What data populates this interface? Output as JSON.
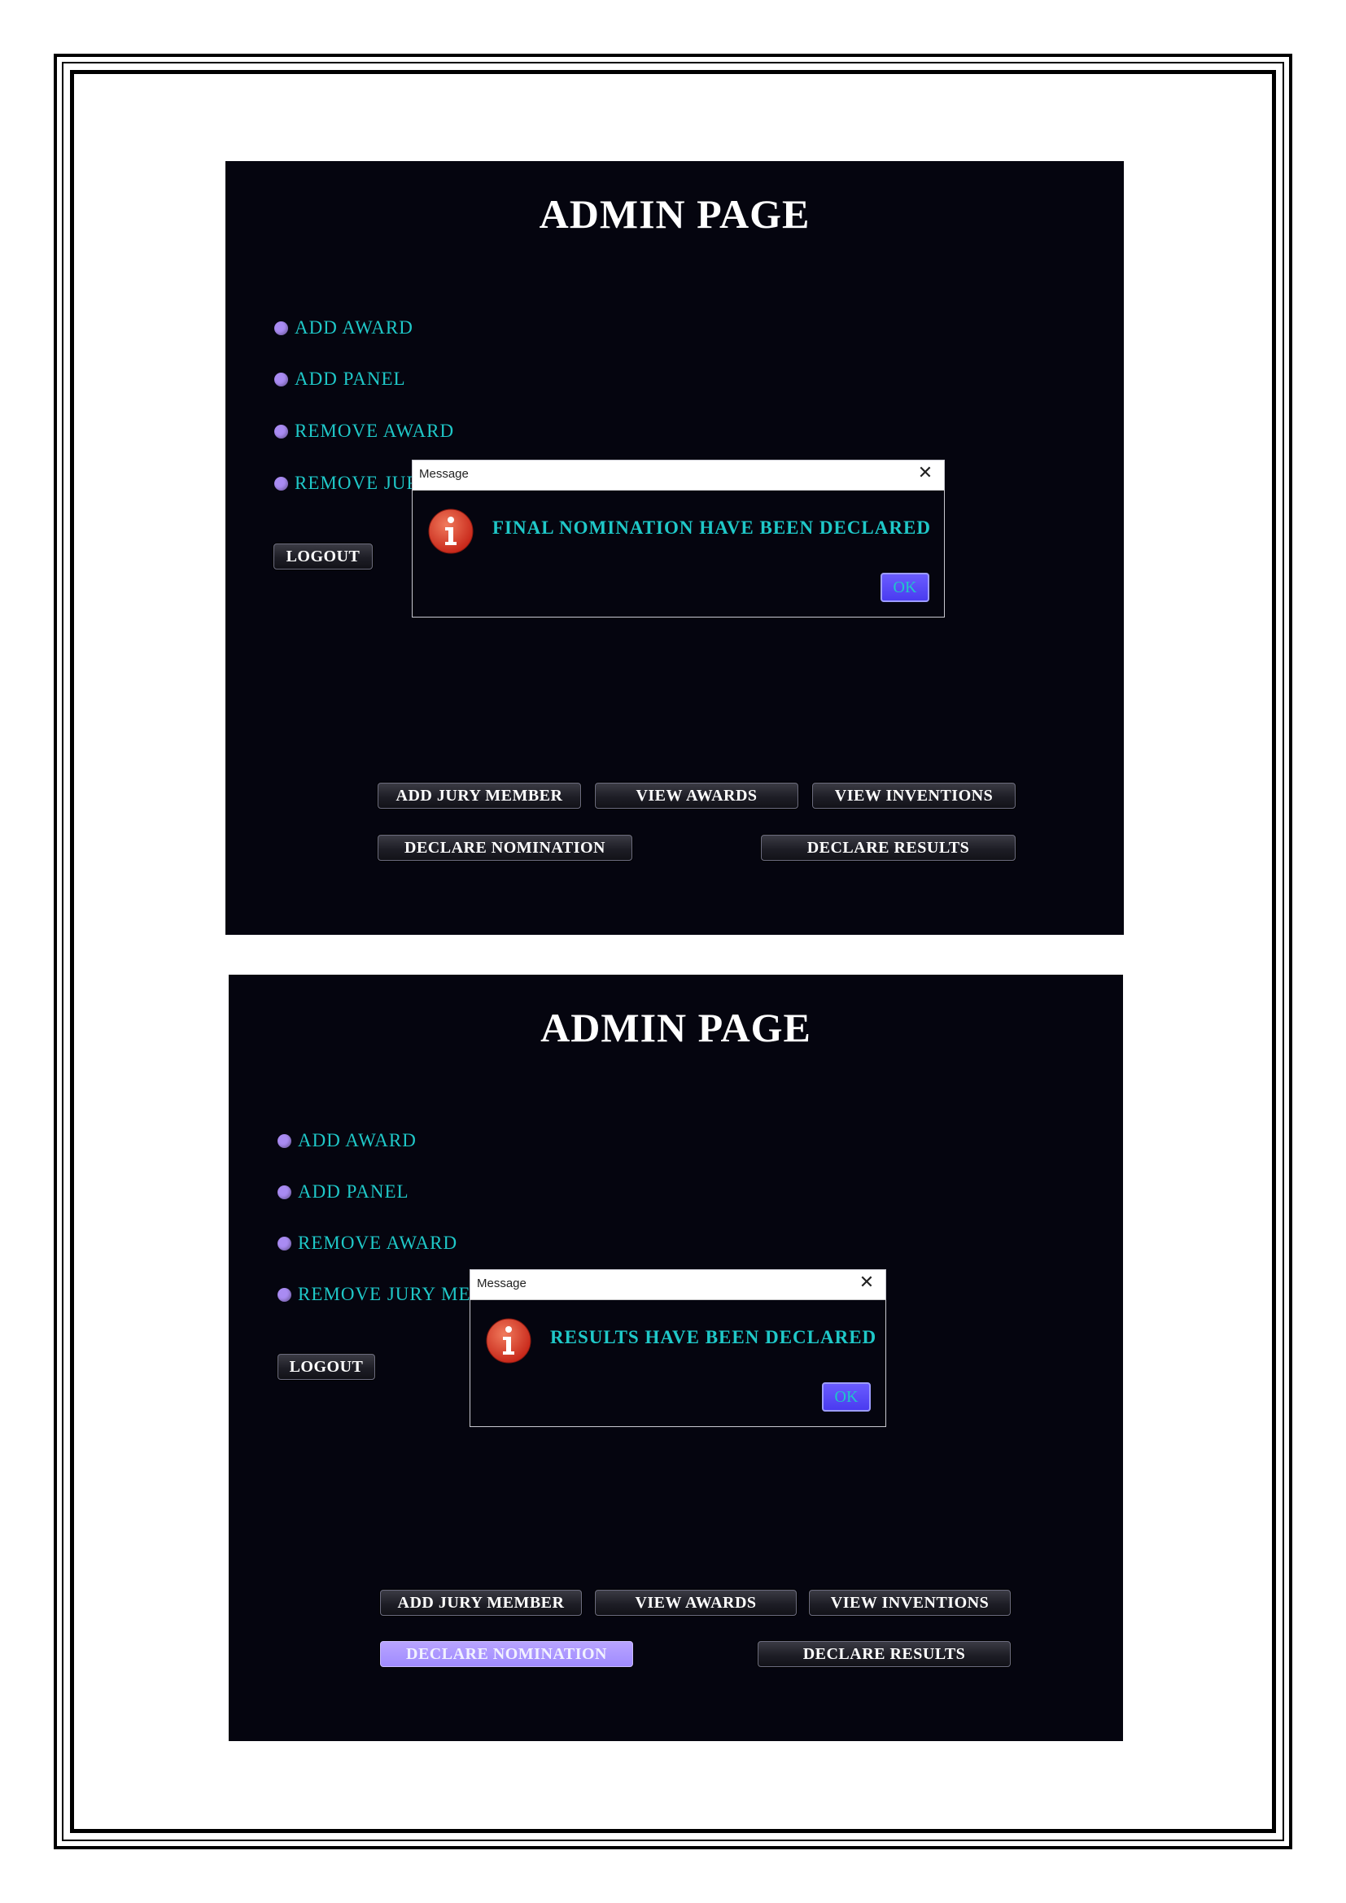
{
  "screens": [
    {
      "title": "ADMIN PAGE",
      "menu": [
        "ADD AWARD",
        "ADD PANEL",
        "REMOVE AWARD",
        "REMOVE JURY MEMBER"
      ],
      "logout_label": "LOGOUT",
      "buttons": {
        "add_jury_member": "ADD JURY MEMBER",
        "view_awards": "VIEW AWARDS",
        "view_inventions": "VIEW INVENTIONS",
        "declare_nomination": "DECLARE NOMINATION",
        "declare_results": "DECLARE RESULTS"
      },
      "declare_nomination_active": false,
      "dialog": {
        "title": "Message",
        "close_icon": "close-icon",
        "icon": "info-icon",
        "message": "FINAL NOMINATION HAVE BEEN DECLARED",
        "ok_label": "OK"
      }
    },
    {
      "title": "ADMIN PAGE",
      "menu": [
        "ADD AWARD",
        "ADD PANEL",
        "REMOVE AWARD",
        "REMOVE JURY MEMBER"
      ],
      "logout_label": "LOGOUT",
      "buttons": {
        "add_jury_member": "ADD JURY MEMBER",
        "view_awards": "VIEW AWARDS",
        "view_inventions": "VIEW INVENTIONS",
        "declare_nomination": "DECLARE NOMINATION",
        "declare_results": "DECLARE RESULTS"
      },
      "declare_nomination_active": true,
      "dialog": {
        "title": "Message",
        "close_icon": "close-icon",
        "icon": "info-icon",
        "message": "RESULTS HAVE BEEN DECLARED",
        "ok_label": "OK"
      }
    }
  ],
  "colors": {
    "background": "#05050f",
    "menu_text": "#1fc8c8",
    "bullet": "#a98bf2",
    "ok_button": "#5a4cf8",
    "active_button": "#a08bff"
  }
}
